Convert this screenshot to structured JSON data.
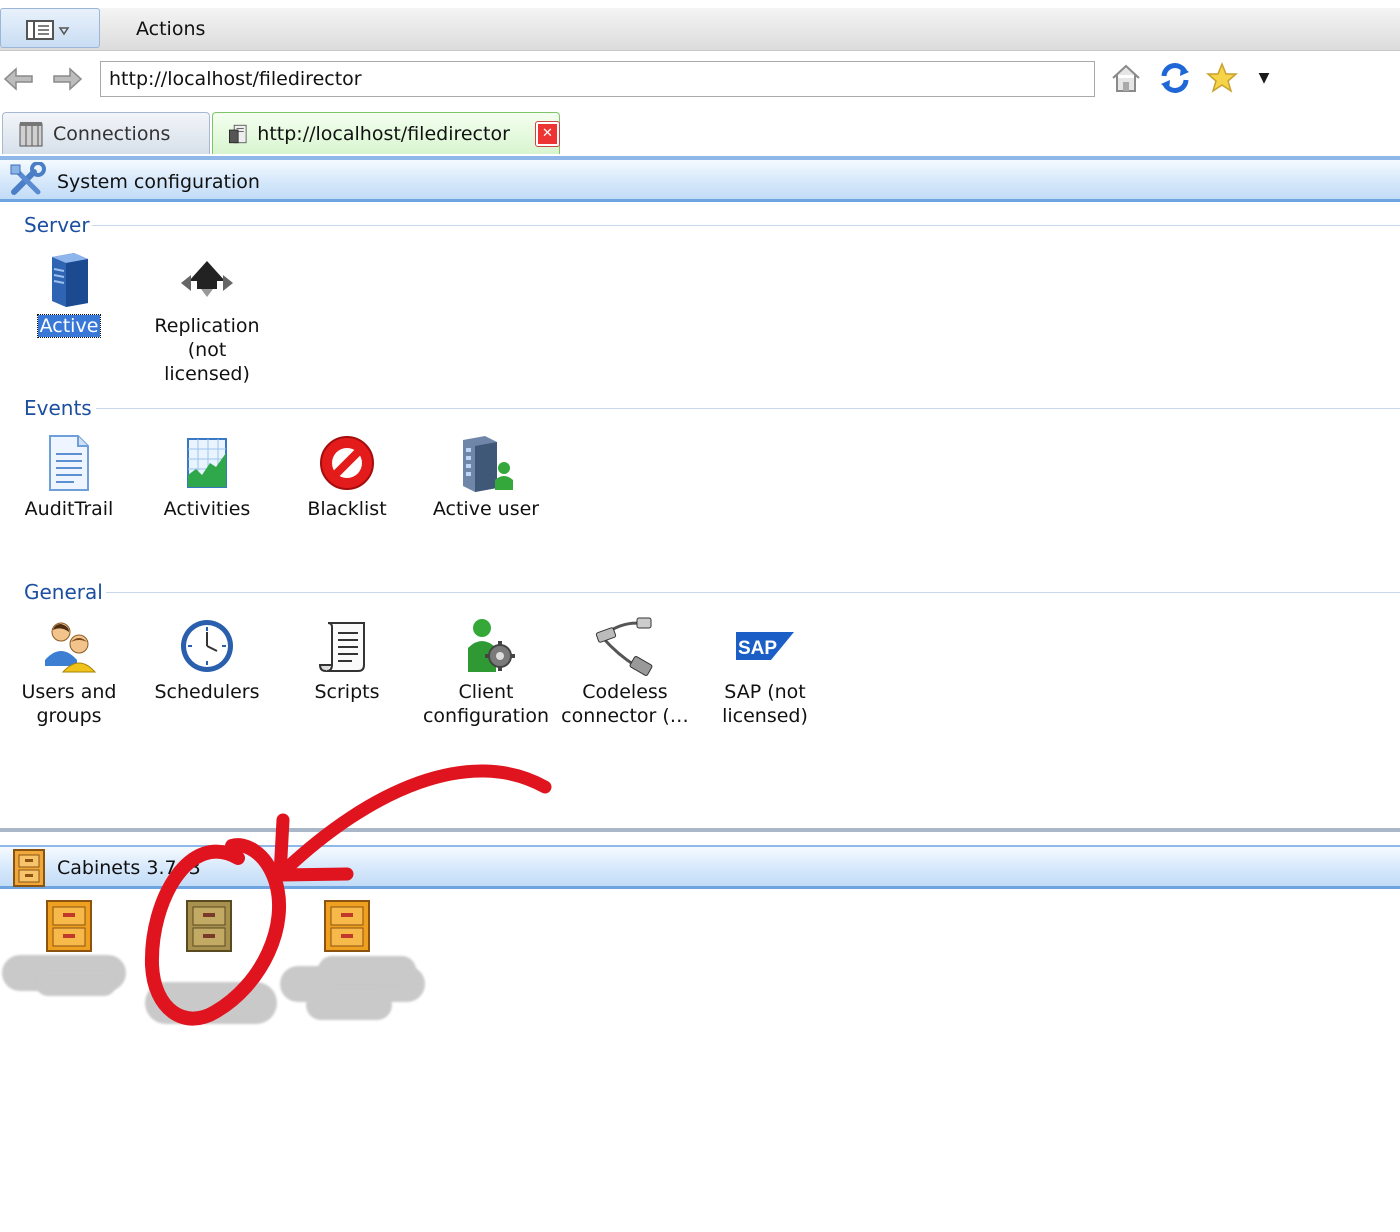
{
  "menubar": {
    "actions_label": "Actions"
  },
  "address": {
    "url": "http://localhost/filedirector"
  },
  "tabs": [
    {
      "label": "Connections"
    },
    {
      "label": "http://localhost/filedirector"
    }
  ],
  "system_config": {
    "title": "System configuration"
  },
  "groups": {
    "server": {
      "label": "Server",
      "items": [
        {
          "label": "Active",
          "icon": "server-icon"
        },
        {
          "label": "Replication\n(not licensed)",
          "icon": "replication-icon"
        }
      ]
    },
    "events": {
      "label": "Events",
      "items": [
        {
          "label": "AuditTrail",
          "icon": "document-icon"
        },
        {
          "label": "Activities",
          "icon": "chart-icon"
        },
        {
          "label": "Blacklist",
          "icon": "no-entry-icon"
        },
        {
          "label": "Active user",
          "icon": "building-user-icon"
        }
      ]
    },
    "general": {
      "label": "General",
      "items": [
        {
          "label": "Users and groups",
          "icon": "users-icon"
        },
        {
          "label": "Schedulers",
          "icon": "clock-icon"
        },
        {
          "label": "Scripts",
          "icon": "scroll-icon"
        },
        {
          "label": "Client configuration",
          "icon": "user-gear-icon"
        },
        {
          "label": "Codeless connector (…",
          "icon": "connector-icon"
        },
        {
          "label": "SAP (not licensed)",
          "icon": "sap-logo"
        }
      ]
    }
  },
  "cabinets": {
    "title": "Cabinets 3.7 .3"
  },
  "colors": {
    "accent": "#3a78d8",
    "header_blue": "#c2dcf7",
    "annotation_red": "#e0141e"
  }
}
